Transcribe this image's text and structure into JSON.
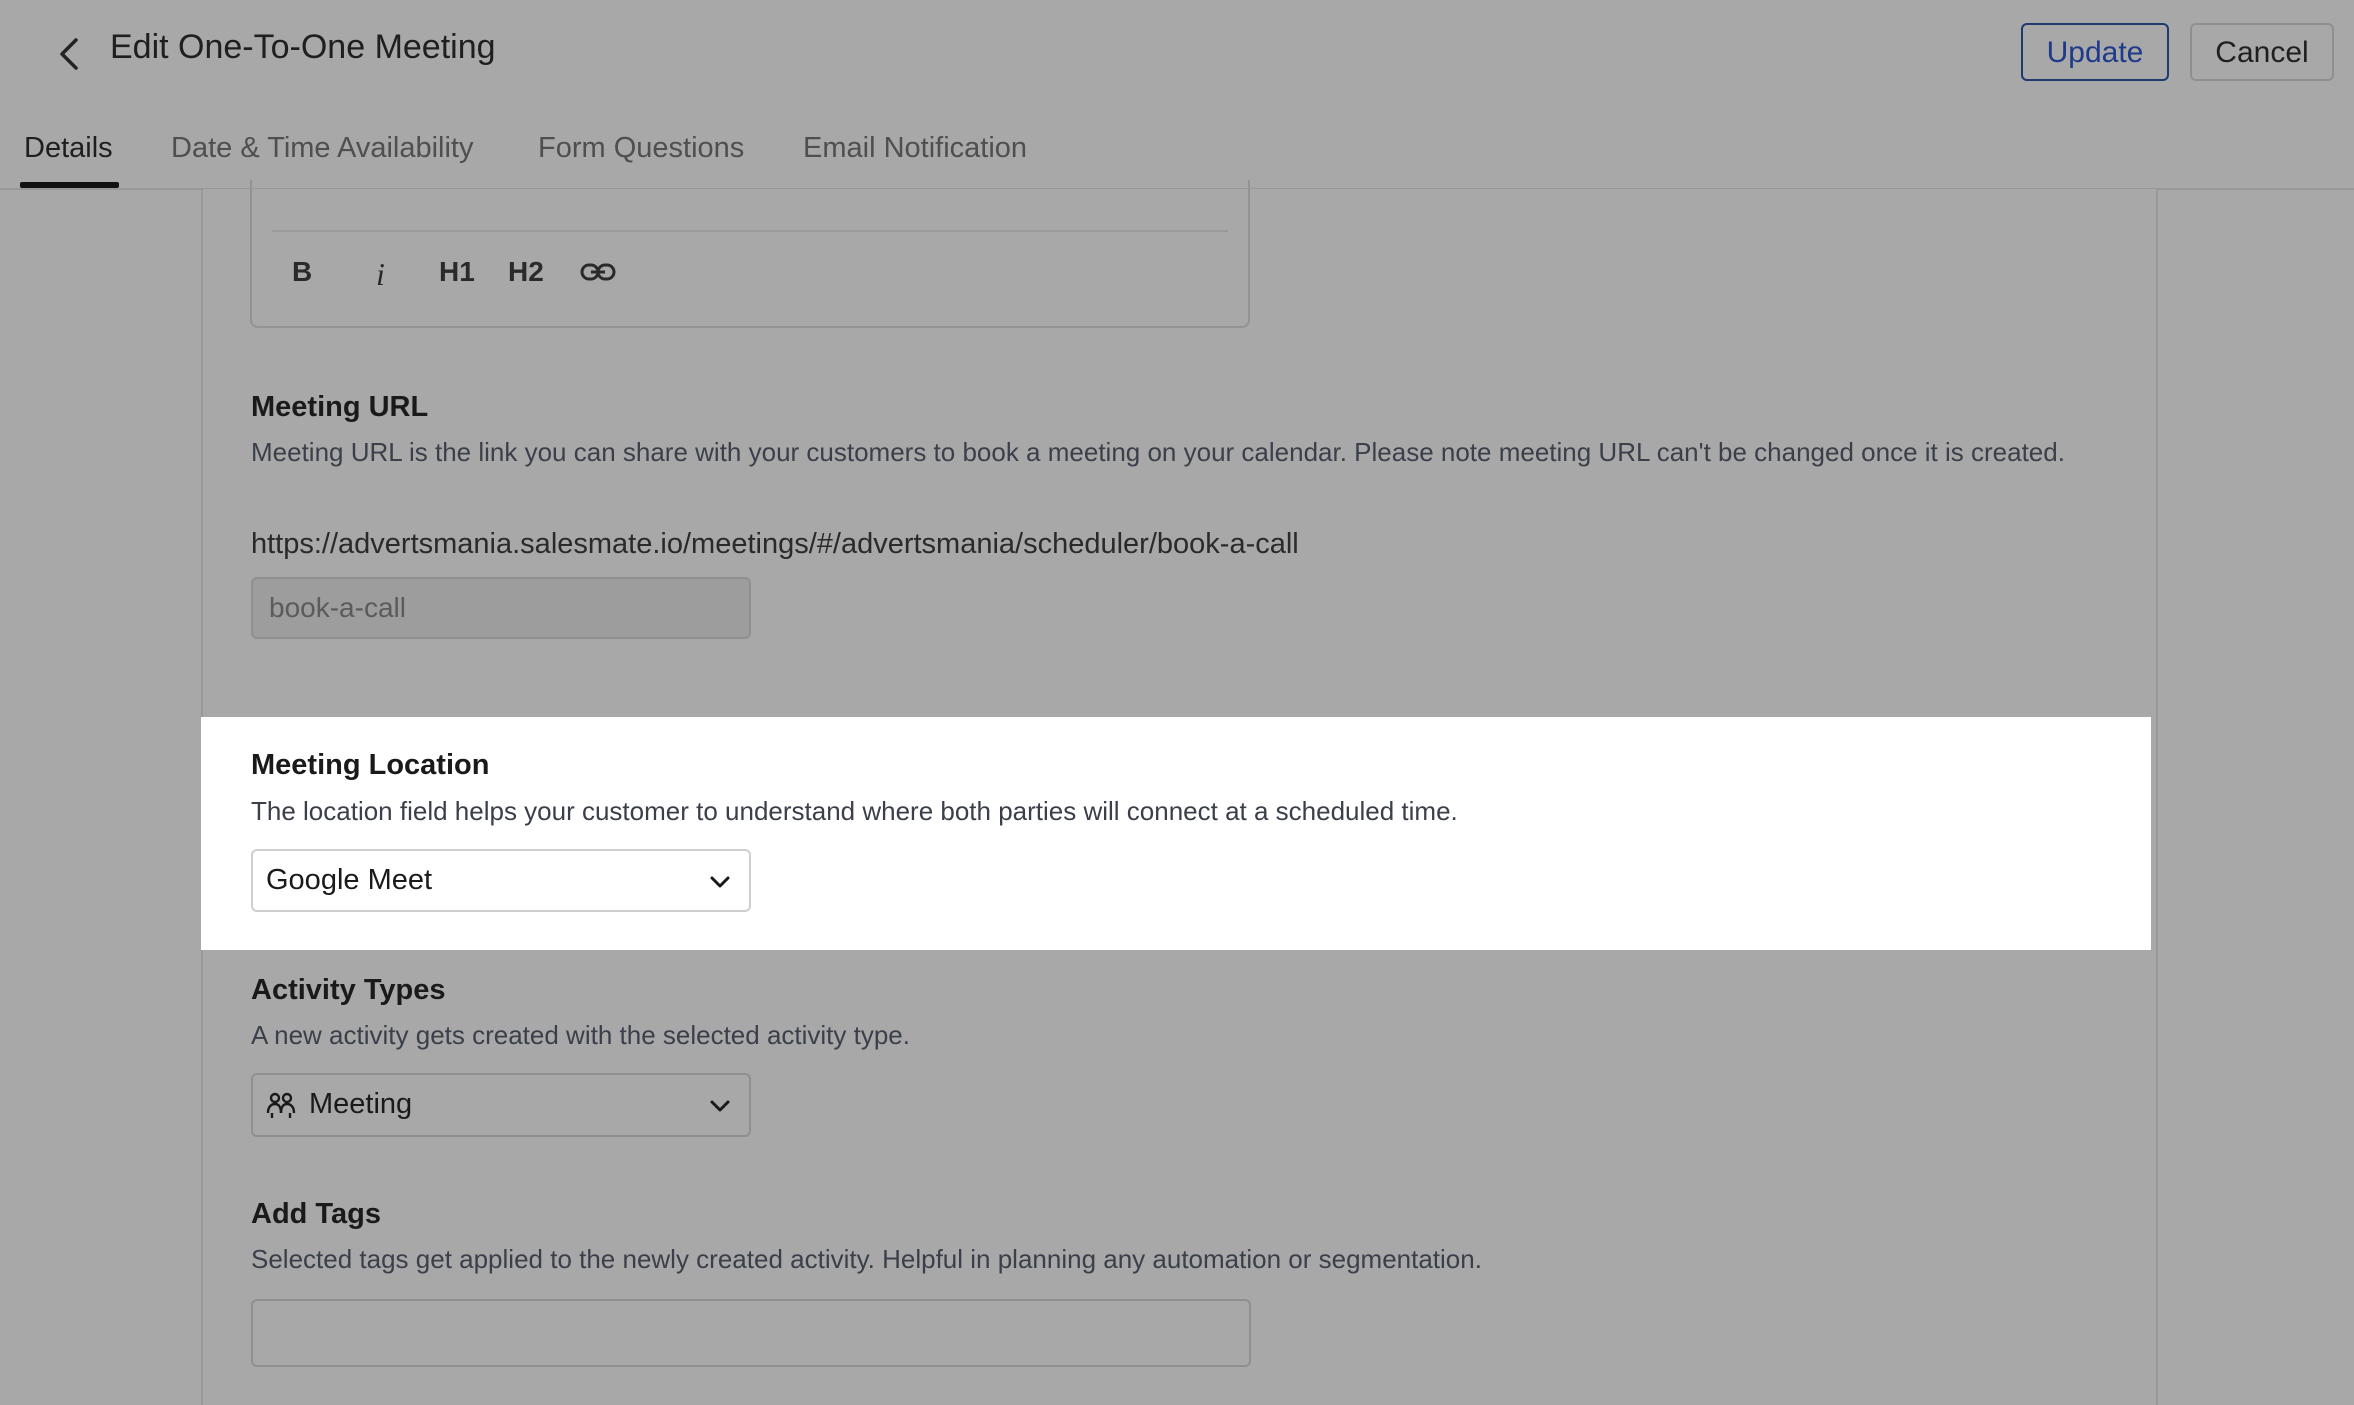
{
  "header": {
    "title": "Edit One-To-One Meeting",
    "update_label": "Update",
    "cancel_label": "Cancel"
  },
  "tabs": [
    {
      "label": "Details",
      "active": true
    },
    {
      "label": "Date & Time Availability",
      "active": false
    },
    {
      "label": "Form Questions",
      "active": false
    },
    {
      "label": "Email Notification",
      "active": false
    }
  ],
  "editor_toolbar": {
    "bold_label": "B",
    "italic_label": "i",
    "h1_label": "H1",
    "h2_label": "H2",
    "link_icon": "link-icon"
  },
  "meeting_url": {
    "title": "Meeting URL",
    "description": "Meeting URL is the link you can share with your customers to book a meeting on your calendar. Please note meeting URL can't be changed once it is created.",
    "base_url": "https://advertsmania.salesmate.io/meetings/#/advertsmania/scheduler/book-a-call",
    "slug_value": "book-a-call"
  },
  "meeting_location": {
    "title": "Meeting Location",
    "description": "The location field helps your customer to understand where both parties will connect at a scheduled time.",
    "selected": "Google Meet"
  },
  "activity_types": {
    "title": "Activity Types",
    "description": "A new activity gets created with the selected activity type.",
    "selected": "Meeting",
    "icon": "people-icon"
  },
  "add_tags": {
    "title": "Add Tags",
    "description": "Selected tags get applied to the newly created activity. Helpful in planning any automation or segmentation.",
    "value": ""
  },
  "colors": {
    "overlay": "#a8a8a8",
    "highlight": "#ffffff",
    "primary": "#1e3a8a"
  }
}
